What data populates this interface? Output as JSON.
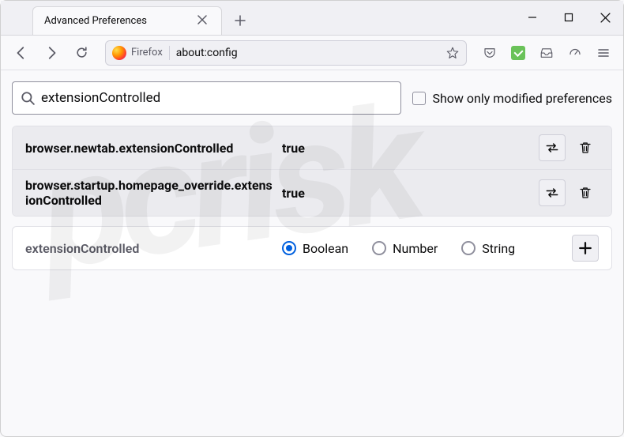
{
  "window": {
    "tab_title": "Advanced Preferences"
  },
  "urlbar": {
    "identity_label": "Firefox",
    "url": "about:config"
  },
  "search": {
    "value": "extensionControlled",
    "checkbox_label": "Show only modified preferences"
  },
  "prefs": [
    {
      "name": "browser.newtab.extensionControlled",
      "value": "true",
      "modified": true
    },
    {
      "name": "browser.startup.homepage_override.extensionControlled",
      "value": "true",
      "modified": true
    }
  ],
  "new_pref": {
    "name": "extensionControlled",
    "types": {
      "boolean": "Boolean",
      "number": "Number",
      "string": "String"
    },
    "selected": "boolean"
  }
}
